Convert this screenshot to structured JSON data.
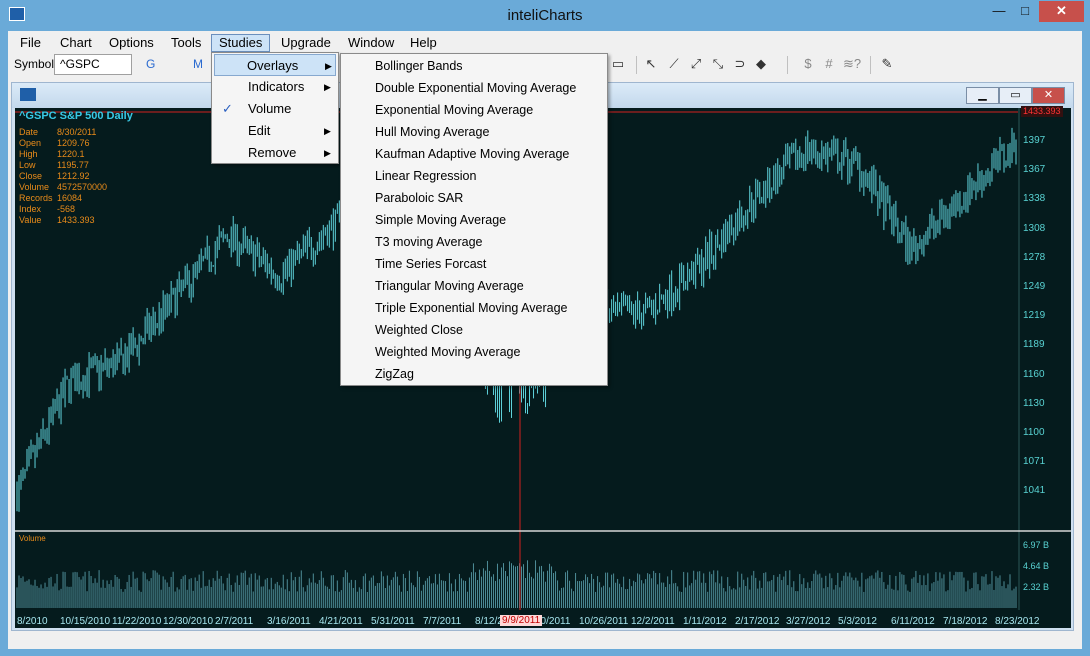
{
  "window": {
    "title": "inteliCharts",
    "minimize_glyph": "—",
    "maximize_glyph": "□",
    "close_glyph": "✕"
  },
  "menu": [
    "File",
    "Chart",
    "Options",
    "Tools",
    "Studies",
    "Upgrade",
    "Window",
    "Help"
  ],
  "toolbar": {
    "symbol_label": "Symbol",
    "symbol_value": "^GSPC",
    "g_label": "G",
    "m_label": "M",
    "dollar_label": "$",
    "hash_label": "#",
    "wave_label": "≋?"
  },
  "studies_menu": [
    {
      "label": "Overlays",
      "submenu": true,
      "checked": false
    },
    {
      "label": "Indicators",
      "submenu": true,
      "checked": false
    },
    {
      "label": "Volume",
      "submenu": false,
      "checked": true
    },
    {
      "label": "Edit",
      "submenu": true,
      "checked": false
    },
    {
      "label": "Remove",
      "submenu": true,
      "checked": false
    }
  ],
  "overlays_menu": [
    "Bollinger Bands",
    "Double Exponential Moving Average",
    "Exponential Moving Average",
    "Hull Moving Average",
    "Kaufman Adaptive Moving Average",
    "Linear Regression",
    "Paraboloic SAR",
    "Simple Moving Average",
    "T3 moving Average",
    "Time Series Forcast",
    "Triangular Moving Average",
    "Triple Exponential Moving Average",
    "Weighted Close",
    "Weighted Moving Average",
    "ZigZag"
  ],
  "chart": {
    "header": "^GSPC   S&P 500   Daily",
    "info_labels": [
      "Date",
      "Open",
      "High",
      "Low",
      "Close",
      "Volume",
      "Records",
      "Index",
      "Value"
    ],
    "info_values": [
      "8/30/2011",
      "1209.76",
      "1220.1",
      "1195.77",
      "1212.92",
      "4572570000",
      "16084",
      "-568",
      "1433.393"
    ],
    "price_tag": "1433.393",
    "y_ticks": [
      "1397",
      "1367",
      "1338",
      "1308",
      "1278",
      "1249",
      "1219",
      "1189",
      "1160",
      "1130",
      "1100",
      "1071",
      "1041"
    ],
    "volume_label": "Volume",
    "volume_ticks": [
      "6.97 B",
      "4.64 B",
      "2.32 B"
    ],
    "x_ticks": [
      "8/2010",
      "10/15/2010",
      "11/22/2010",
      "12/30/2010",
      "2/7/2011",
      "3/16/2011",
      "4/21/2011",
      "5/31/2011",
      "7/7/2011",
      "8/12/2",
      "10/2011",
      "10/26/2011",
      "12/2/2011",
      "1/11/2012",
      "2/17/2012",
      "3/27/2012",
      "5/3/2012",
      "6/11/2012",
      "7/18/2012",
      "8/23/2012"
    ],
    "cursor_date": "9/9/2011",
    "colors": {
      "background": "#051b1d",
      "bars": "#5fd3dc",
      "volume": "#4e8d98",
      "crosshair": "#d12020",
      "text": "#e88b1a"
    }
  },
  "chart_data": {
    "type": "bar",
    "title": "^GSPC S&P 500 Daily",
    "xlabel": "",
    "ylabel": "",
    "ylim": [
      1030,
      1440
    ],
    "x": [
      "8/2010",
      "10/15/2010",
      "11/22/2010",
      "12/30/2010",
      "2/7/2011",
      "3/16/2011",
      "4/21/2011",
      "5/31/2011",
      "7/7/2011",
      "8/12/2011",
      "10/2011",
      "10/26/2011",
      "12/2/2011",
      "1/11/2012",
      "2/17/2012",
      "3/27/2012",
      "5/3/2012",
      "6/11/2012",
      "7/18/2012",
      "8/23/2012"
    ],
    "series": [
      {
        "name": "Close",
        "values": [
          1065,
          1175,
          1195,
          1257,
          1320,
          1280,
          1330,
          1345,
          1335,
          1180,
          1200,
          1240,
          1245,
          1290,
          1355,
          1405,
          1390,
          1305,
          1360,
          1410
        ]
      }
    ],
    "volume": {
      "ylim_label": "6.97 B"
    }
  }
}
